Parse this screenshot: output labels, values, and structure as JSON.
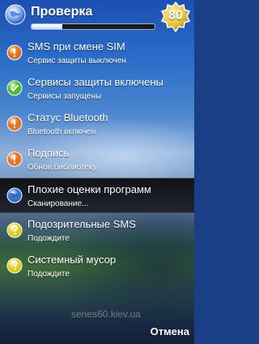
{
  "header": {
    "title": "Проверка",
    "progress": 0.25,
    "badge": "80",
    "icon": "globe-icon"
  },
  "items": [
    {
      "title": "SMS при смене SIM",
      "subtitle": "Сервис защиты выключен",
      "status": "orange",
      "icon": "warning-icon"
    },
    {
      "title": "Сервисы защиты включены",
      "subtitle": "Сервисы запущены",
      "status": "green",
      "icon": "ok-icon"
    },
    {
      "title": "Статус Bluetooth",
      "subtitle": "Bluetooth включен",
      "status": "orange",
      "icon": "warning-icon"
    },
    {
      "title": "Подпись",
      "subtitle": "Обнов.библиотеку",
      "status": "orange",
      "icon": "warning-icon"
    },
    {
      "title": "Плохие оценки программ",
      "subtitle": "Сканирование...",
      "status": "blue",
      "icon": "globe-icon"
    },
    {
      "title": "Подозрительные SMS",
      "subtitle": "Подождите",
      "status": "yellow",
      "icon": "question-icon"
    },
    {
      "title": "Системный мусор",
      "subtitle": "Подождите",
      "status": "yellow",
      "icon": "question-icon"
    }
  ],
  "selected_index": 4,
  "watermark": "series60.kiev.ua",
  "softkeys": {
    "right": "Отмена"
  },
  "colors": {
    "orange": "#e8731c",
    "green": "#4cc11d",
    "yellow": "#e6d21a",
    "blue": "#3a78d8",
    "badge": "#e8c33a"
  }
}
